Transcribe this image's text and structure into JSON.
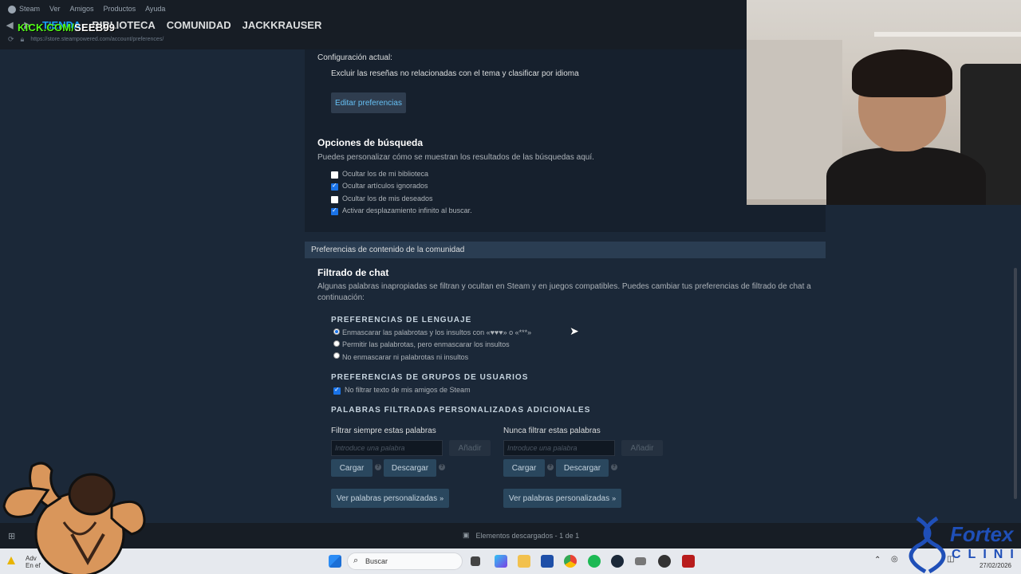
{
  "menu": {
    "app": "Steam",
    "items": [
      "Ver",
      "Amigos",
      "Productos",
      "Ayuda"
    ]
  },
  "nav": {
    "tabs": [
      "TIENDA",
      "BIBLIOTECA",
      "COMUNIDAD",
      "JACKKRAUSER"
    ]
  },
  "overlay_kick": {
    "prefix": "KICK.COM/",
    "user": "SEEB99"
  },
  "url": "https://store.steampowered.com/account/preferences/",
  "reviews": {
    "current_label": "Configuración actual:",
    "current_value": "Excluir las reseñas no relacionadas con el tema y clasificar por idioma",
    "edit_button": "Editar preferencias"
  },
  "search_options": {
    "title": "Opciones de búsqueda",
    "description": "Puedes personalizar cómo se muestran los resultados de las búsquedas aquí.",
    "options": [
      {
        "label": "Ocultar los de mi biblioteca",
        "checked": false
      },
      {
        "label": "Ocultar artículos ignorados",
        "checked": true
      },
      {
        "label": "Ocultar los de mis deseados",
        "checked": false
      },
      {
        "label": "Activar desplazamiento infinito al buscar.",
        "checked": true
      }
    ]
  },
  "community": {
    "section_title": "Preferencias de contenido de la comunidad",
    "chat_title": "Filtrado de chat",
    "chat_desc_1": "Algunas palabras inapropiadas se filtran y ocultan en Steam y en juegos compatibles. Puedes cambiar tus preferencias de filtrado de chat a",
    "chat_desc_2": "continuación:",
    "language_title": "PREFERENCIAS DE LENGUAJE",
    "language_options": [
      {
        "label": "Enmascarar las palabrotas y los insultos con «♥♥♥» o «***»",
        "selected": true
      },
      {
        "label": "Permitir las palabrotas, pero enmascarar los insultos",
        "selected": false
      },
      {
        "label": "No enmascarar ni palabrotas ni insultos",
        "selected": false
      }
    ],
    "groups_title": "PREFERENCIAS DE GRUPOS DE USUARIOS",
    "groups_option": "No filtrar texto de mis amigos de Steam",
    "custom_title": "PALABRAS FILTRADAS PERSONALIZADAS ADICIONALES",
    "always": {
      "label": "Filtrar siempre estas palabras",
      "placeholder": "Introduce una palabra",
      "add": "Añadir",
      "load": "Cargar",
      "download": "Descargar",
      "view": "Ver palabras personalizadas"
    },
    "never": {
      "label": "Nunca filtrar estas palabras",
      "placeholder": "Introduce una palabra",
      "add": "Añadir",
      "load": "Cargar",
      "download": "Descargar",
      "view": "Ver palabras personalizadas"
    }
  },
  "status": {
    "downloads": "Elementos descargados - 1 de 1"
  },
  "taskbar": {
    "search": "Buscar",
    "notif_1": "Adv",
    "notif_2": "En ef",
    "date": "27/02/2026"
  },
  "fortex": {
    "line1": "Fortex",
    "line2": "CLINIC"
  }
}
